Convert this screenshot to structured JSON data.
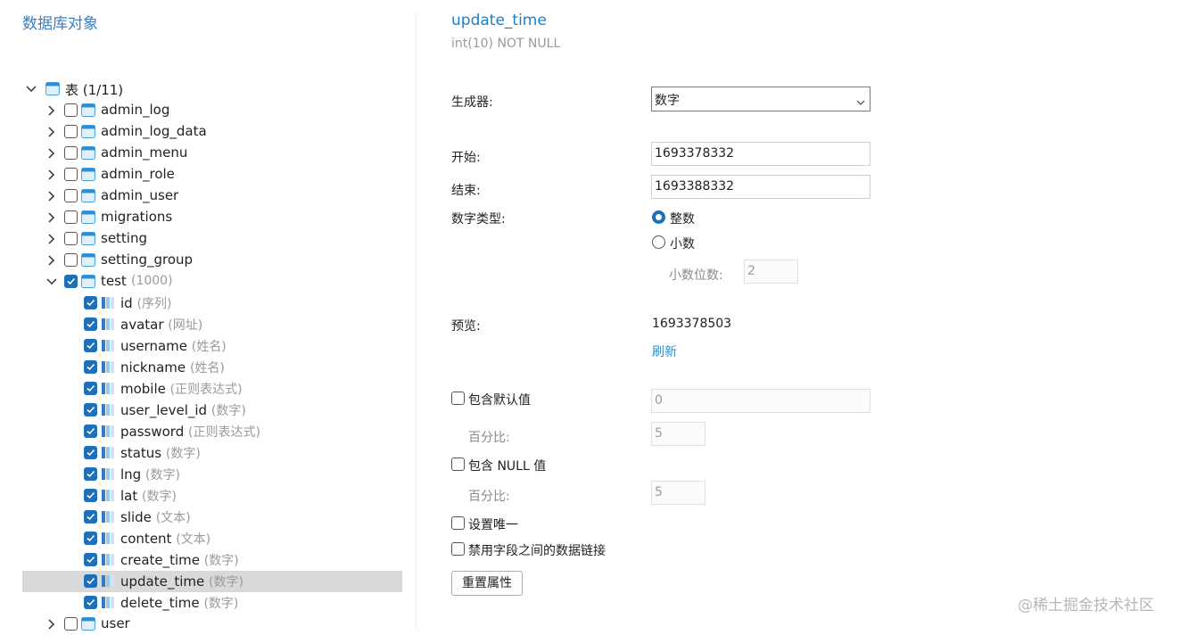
{
  "left_panel": {
    "title": "数据库对象",
    "tables_group": {
      "label": "表 (1/11)"
    },
    "tables": [
      {
        "name": "admin_log",
        "checked": false,
        "expanded": false
      },
      {
        "name": "admin_log_data",
        "checked": false,
        "expanded": false
      },
      {
        "name": "admin_menu",
        "checked": false,
        "expanded": false
      },
      {
        "name": "admin_role",
        "checked": false,
        "expanded": false
      },
      {
        "name": "admin_user",
        "checked": false,
        "expanded": false
      },
      {
        "name": "migrations",
        "checked": false,
        "expanded": false
      },
      {
        "name": "setting",
        "checked": false,
        "expanded": false
      },
      {
        "name": "setting_group",
        "checked": false,
        "expanded": false
      },
      {
        "name": "test",
        "count": "(1000)",
        "checked": true,
        "expanded": true
      },
      {
        "name": "user",
        "checked": false,
        "expanded": false
      }
    ],
    "test_columns": [
      {
        "name": "id",
        "generator": "(序列)",
        "checked": true
      },
      {
        "name": "avatar",
        "generator": "(网址)",
        "checked": true
      },
      {
        "name": "username",
        "generator": "(姓名)",
        "checked": true
      },
      {
        "name": "nickname",
        "generator": "(姓名)",
        "checked": true
      },
      {
        "name": "mobile",
        "generator": "(正则表达式)",
        "checked": true
      },
      {
        "name": "user_level_id",
        "generator": "(数字)",
        "checked": true
      },
      {
        "name": "password",
        "generator": "(正则表达式)",
        "checked": true
      },
      {
        "name": "status",
        "generator": "(数字)",
        "checked": true
      },
      {
        "name": "lng",
        "generator": "(数字)",
        "checked": true
      },
      {
        "name": "lat",
        "generator": "(数字)",
        "checked": true
      },
      {
        "name": "slide",
        "generator": "(文本)",
        "checked": true
      },
      {
        "name": "content",
        "generator": "(文本)",
        "checked": true
      },
      {
        "name": "create_time",
        "generator": "(数字)",
        "checked": true
      },
      {
        "name": "update_time",
        "generator": "(数字)",
        "checked": true,
        "selected": true
      },
      {
        "name": "delete_time",
        "generator": "(数字)",
        "checked": true
      }
    ]
  },
  "field": {
    "name": "update_time",
    "type": "int(10) NOT NULL"
  },
  "form": {
    "generator_label": "生成器:",
    "generator_value": "数字",
    "start_label": "开始:",
    "start_value": "1693378332",
    "end_label": "结束:",
    "end_value": "1693388332",
    "number_type_label": "数字类型:",
    "integer_label": "整数",
    "decimal_label": "小数",
    "number_type_selected": "整数",
    "decimal_places_label": "小数位数:",
    "decimal_places_value": "2",
    "preview_label": "预览:",
    "preview_value": "1693378503",
    "refresh_label": "刷新",
    "include_default_label": "包含默认值",
    "include_default_checked": false,
    "default_value": "0",
    "default_percent_label": "百分比:",
    "default_percent_value": "5",
    "include_null_label": "包含 NULL 值",
    "include_null_checked": false,
    "null_percent_label": "百分比:",
    "null_percent_value": "5",
    "unique_label": "设置唯一",
    "unique_checked": false,
    "disable_link_label": "禁用字段之间的数据链接",
    "disable_link_checked": false,
    "reset_button": "重置属性"
  },
  "watermark": "@稀土掘金技术社区",
  "colors": {
    "accent": "#1d6fb8",
    "title_blue": "#1d7fc6",
    "link": "#2b8fd0",
    "selected_row": "#d9d9d9",
    "hint_gray": "#9a9a9a"
  },
  "icons": {
    "table": "table-icon",
    "column": "column-icon",
    "expand": "chevron-right-icon",
    "collapse": "chevron-down-icon",
    "dropdown": "chevron-down-icon"
  }
}
